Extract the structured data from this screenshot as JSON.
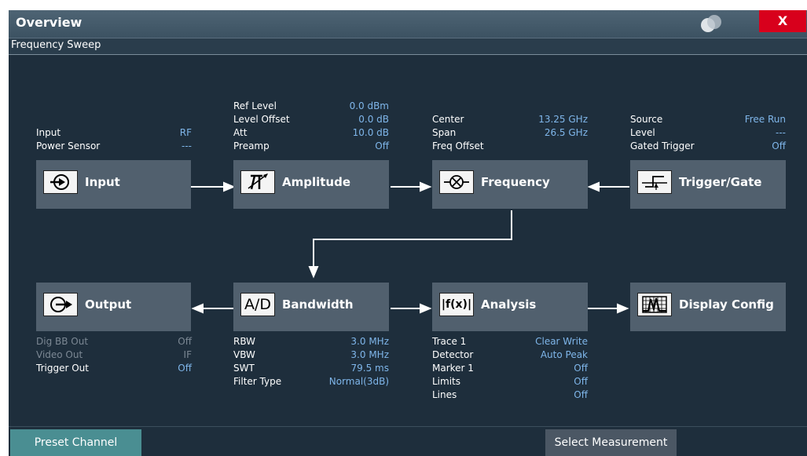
{
  "window": {
    "title": "Overview",
    "close_label": "X",
    "subtitle": "Frequency Sweep"
  },
  "blocks": {
    "input": {
      "label": "Input",
      "icon": "input-icon"
    },
    "amplitude": {
      "label": "Amplitude",
      "icon": "amplitude-icon"
    },
    "frequency": {
      "label": "Frequency",
      "icon": "frequency-mixer-icon"
    },
    "trigger": {
      "label": "Trigger/Gate",
      "icon": "trigger-icon"
    },
    "output": {
      "label": "Output",
      "icon": "output-icon"
    },
    "bandwidth": {
      "label": "Bandwidth",
      "icon": "ad-converter-icon",
      "icon_text": "A/D"
    },
    "analysis": {
      "label": "Analysis",
      "icon": "analysis-icon",
      "icon_text": "|f(x)|"
    },
    "display": {
      "label": "Display Config",
      "icon": "display-config-icon"
    }
  },
  "info": {
    "input": [
      {
        "k": "Input",
        "v": "RF"
      },
      {
        "k": "Power Sensor",
        "v": "---"
      }
    ],
    "amplitude": [
      {
        "k": "Ref Level",
        "v": "0.0 dBm"
      },
      {
        "k": "Level Offset",
        "v": "0.0 dB"
      },
      {
        "k": "Att",
        "v": "10.0 dB"
      },
      {
        "k": "Preamp",
        "v": "Off"
      }
    ],
    "frequency": [
      {
        "k": "Center",
        "v": "13.25 GHz"
      },
      {
        "k": "Span",
        "v": "26.5 GHz"
      },
      {
        "k": "Freq Offset",
        "v": ""
      }
    ],
    "trigger": [
      {
        "k": "Source",
        "v": "Free Run"
      },
      {
        "k": "Level",
        "v": "---"
      },
      {
        "k": "Gated Trigger",
        "v": "Off"
      }
    ],
    "output": [
      {
        "k": "Dig BB Out",
        "v": "Off"
      },
      {
        "k": "Video Out",
        "v": "IF"
      },
      {
        "k": "Trigger Out",
        "v": "Off"
      }
    ],
    "bandwidth": [
      {
        "k": "RBW",
        "v": "3.0 MHz"
      },
      {
        "k": "VBW",
        "v": "3.0 MHz"
      },
      {
        "k": "SWT",
        "v": "79.5 ms"
      },
      {
        "k": "Filter Type",
        "v": "Normal(3dB)"
      }
    ],
    "analysis": [
      {
        "k": "Trace 1",
        "v": "Clear Write"
      },
      {
        "k": "Detector",
        "v": "Auto Peak"
      },
      {
        "k": "Marker 1",
        "v": "Off"
      },
      {
        "k": "Limits",
        "v": "Off"
      },
      {
        "k": "Lines",
        "v": "Off"
      }
    ]
  },
  "buttons": {
    "preset": "Preset Channel",
    "select": "Select Measurement"
  },
  "colors": {
    "accent_blue": "#7fb6ea",
    "block_bg": "#51606e",
    "close_red": "#d8001c",
    "preset_teal": "#4a8e92"
  }
}
